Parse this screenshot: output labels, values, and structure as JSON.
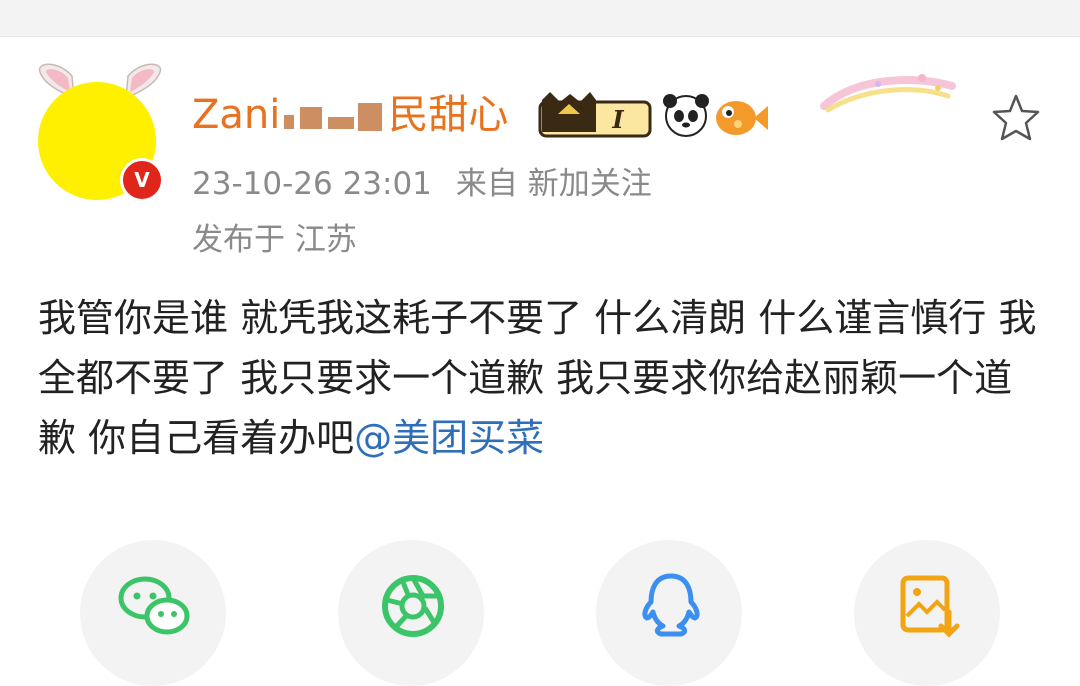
{
  "post": {
    "author": {
      "name_prefix": "Zani",
      "name_suffix": "民甜心",
      "verified_label": "V",
      "member_level": "I"
    },
    "time": "23-10-26 23:01",
    "source": "来自 新加关注",
    "location": "发布于 江苏",
    "content": "我管你是谁 就凭我这耗子不要了 什么清朗 什么谨言慎行  我全都不要了 我只要求一个道歉 我只要求你给赵丽颖一个道歉 你自己看着办吧",
    "mention": "@美团买菜"
  },
  "icons": {
    "favorite": "star-outline-icon",
    "share_targets": [
      "wechat-icon",
      "moments-icon",
      "qq-icon",
      "save-image-icon"
    ]
  },
  "colors": {
    "username": "#e8721e",
    "mention": "#2f6fba",
    "verified": "#e0251b",
    "share_green": "#3cc468",
    "share_blue": "#3a8ff0",
    "share_orange": "#f2a413"
  }
}
